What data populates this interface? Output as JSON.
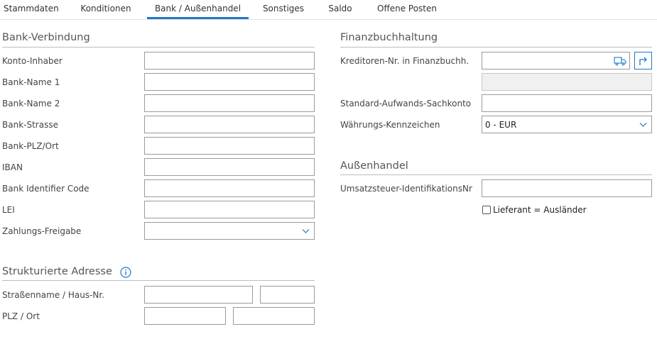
{
  "tabs": [
    {
      "label": "Stammdaten"
    },
    {
      "label": "Konditionen"
    },
    {
      "label": "Bank / Außenhandel"
    },
    {
      "label": "Sonstiges"
    },
    {
      "label": "Saldo"
    },
    {
      "label": "Offene Posten"
    }
  ],
  "active_tab": "Bank / Außenhandel",
  "bank": {
    "title": "Bank-Verbindung",
    "fields": [
      {
        "label": "Konto-Inhaber",
        "value": ""
      },
      {
        "label": "Bank-Name 1",
        "value": ""
      },
      {
        "label": "Bank-Name 2",
        "value": ""
      },
      {
        "label": "Bank-Strasse",
        "value": ""
      },
      {
        "label": "Bank-PLZ/Ort",
        "value": ""
      },
      {
        "label": "IBAN",
        "value": ""
      },
      {
        "label": "Bank Identifier Code",
        "value": ""
      },
      {
        "label": "LEI",
        "value": ""
      },
      {
        "label": "Zahlungs-Freigabe",
        "value": ""
      }
    ]
  },
  "address": {
    "title": "Strukturierte Adresse",
    "street_label": "Straßenname / Haus-Nr.",
    "street_value": "",
    "house_no_value": "",
    "zip_city_label": "PLZ / Ort",
    "zip_value": "",
    "city_value": ""
  },
  "fibu": {
    "title": "Finanzbuchhaltung",
    "kreditor_label": "Kreditoren-Nr. in Finanzbuchh.",
    "kreditor_value": "",
    "kreditor_name_value": "",
    "sachkonto_label": "Standard-Aufwands-Sachkonto",
    "sachkonto_value": "",
    "waehrung_label": "Währungs-Kennzeichen",
    "waehrung_value": "0 - EUR"
  },
  "aussenhandel": {
    "title": "Außenhandel",
    "ustid_label": "Umsatzsteuer-IdentifikationsNr",
    "ustid_value": "",
    "auslaender_label": "Lieferant = Ausländer",
    "auslaender_checked": false
  },
  "colors": {
    "accent": "#1e78c8",
    "text": "#444444",
    "border": "#9a9a9a"
  },
  "icons": {
    "info": "info-icon",
    "lookup": "truck-lookup-icon",
    "jump": "jump-arrow-icon",
    "chevron": "chevron-down-icon"
  }
}
